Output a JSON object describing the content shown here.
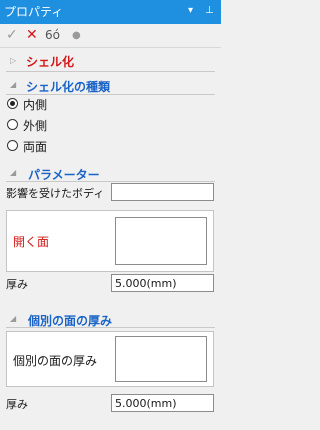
{
  "window": {
    "title": "プロパティ",
    "menu_glyph": "▾",
    "pin_glyph": "⊥"
  },
  "toolbar": {
    "ok_glyph": "✓",
    "cancel_glyph": "✕",
    "preview_glyph": "6ó",
    "dot_glyph": "●"
  },
  "shell": {
    "heading": "シェル化"
  },
  "shell_type": {
    "heading": "シェル化の種類",
    "options": [
      "内側",
      "外側",
      "両面"
    ],
    "selected_index": 0
  },
  "parameters": {
    "heading": "パラメーター",
    "affected_body_label": "影響を受けたボディ",
    "affected_body_value": "",
    "open_face_label": "開く面",
    "thickness_label": "厚み",
    "thickness_value": "5.000(mm)"
  },
  "individual": {
    "heading": "個別の面の厚み",
    "faces_label": "個別の面の厚み",
    "thickness_label": "厚み",
    "thickness_value": "5.000(mm)"
  },
  "colors": {
    "titlebar": "#1f8fe0",
    "heading_red": "#d21818",
    "heading_blue": "#1a64c8"
  }
}
